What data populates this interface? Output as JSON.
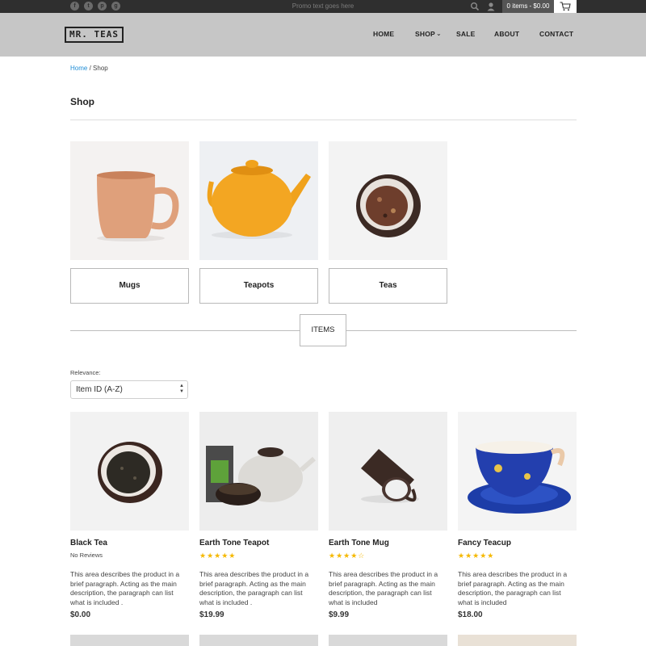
{
  "topbar": {
    "social": [
      "f",
      "t",
      "p",
      "g"
    ],
    "promo": "Promo text goes here",
    "cart_summary": "0 items - $0.00"
  },
  "header": {
    "logo": "MR. TEAS",
    "nav": {
      "home": "HOME",
      "shop": "SHOP",
      "sale": "SALE",
      "about": "ABOUT",
      "contact": "CONTACT"
    }
  },
  "breadcrumb": {
    "home": "Home",
    "sep": "/",
    "current": "Shop"
  },
  "page_title": "Shop",
  "categories": [
    {
      "label": "Mugs",
      "icon": "mug-image"
    },
    {
      "label": "Teapots",
      "icon": "teapot-image"
    },
    {
      "label": "Teas",
      "icon": "tea-bowl-image"
    }
  ],
  "items_label": "ITEMS",
  "sort": {
    "label": "Relevance:",
    "value": "Item ID (A-Z)"
  },
  "products": [
    {
      "name": "Black Tea",
      "reviews": "No Reviews",
      "stars": "",
      "desc": "This area describes the product in a brief paragraph. Acting as the main description, the paragraph can list what is included .",
      "price": "$0.00"
    },
    {
      "name": "Earth Tone Teapot",
      "reviews": "",
      "stars": "★★★★★",
      "desc": "This area describes the product in a brief paragraph. Acting as the main description, the paragraph can list what is included .",
      "price": "$19.99"
    },
    {
      "name": "Earth Tone Mug",
      "reviews": "",
      "stars": "★★★★☆",
      "desc": "This area describes the product in a brief paragraph. Acting as the main description, the paragraph can list what is included",
      "price": "$9.99"
    },
    {
      "name": "Fancy Teacup",
      "reviews": "",
      "stars": "★★★★★",
      "desc": "This area describes the product in a brief paragraph. Acting as the main description, the paragraph can list what is included",
      "price": "$18.00"
    }
  ],
  "colors": {
    "accent_link": "#1f8dd6",
    "star": "#f5b800",
    "header_bg": "#c6c6c6",
    "topbar_bg": "#2f2f2f"
  }
}
